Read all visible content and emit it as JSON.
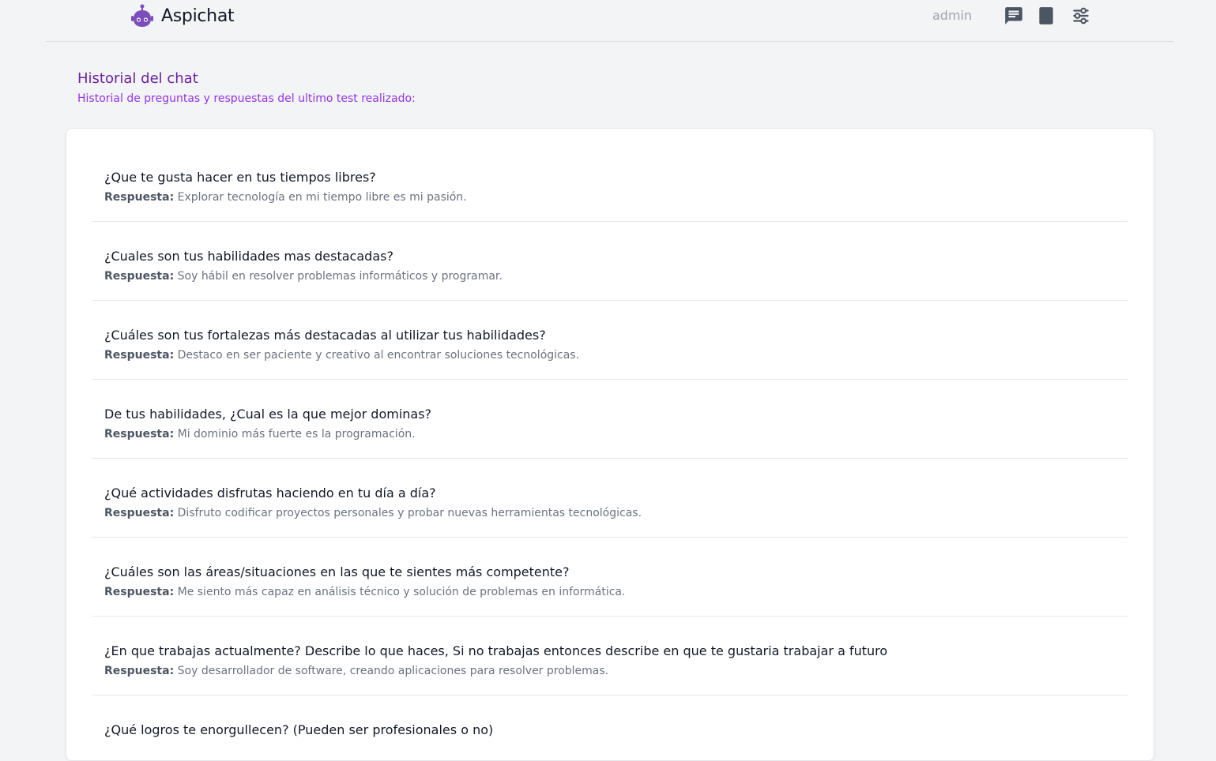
{
  "header": {
    "brand_name": "Aspichat",
    "user_name": "admin",
    "icons": [
      "chat-icon",
      "book-icon",
      "settings-sliders-icon"
    ]
  },
  "page": {
    "title": "Historial del chat",
    "subtitle": "Historial de preguntas y respuestas del ultimo test realizado:"
  },
  "qa": {
    "answer_label": "Respuesta:",
    "items": [
      {
        "question": "¿Que te gusta hacer en tus tiempos libres?",
        "answer": "Explorar tecnología en mi tiempo libre es mi pasión."
      },
      {
        "question": "¿Cuales son tus habilidades mas destacadas?",
        "answer": "Soy hábil en resolver problemas informáticos y programar."
      },
      {
        "question": "¿Cuáles son tus fortalezas más destacadas al utilizar tus habilidades?",
        "answer": "Destaco en ser paciente y creativo al encontrar soluciones tecnológicas."
      },
      {
        "question": "De tus habilidades, ¿Cual es la que mejor dominas?",
        "answer": "Mi dominio más fuerte es la programación."
      },
      {
        "question": "¿Qué actividades disfrutas haciendo en tu día a día?",
        "answer": "Disfruto codificar proyectos personales y probar nuevas herramientas tecnológicas."
      },
      {
        "question": "¿Cuáles son las áreas/situaciones en las que te sientes más competente?",
        "answer": "Me siento más capaz en análisis técnico y solución de problemas en informática."
      },
      {
        "question": "¿En que trabajas actualmente? Describe lo que haces, Si no trabajas entonces describe en que te gustaria trabajar a futuro",
        "answer": "Soy desarrollador de software, creando aplicaciones para resolver problemas."
      },
      {
        "question": "¿Qué logros te enorgullecen? (Pueden ser profesionales o no)",
        "answer": ""
      }
    ]
  },
  "colors": {
    "brand_purple": "#7c4dbc",
    "title_purple": "#6b21a8",
    "subtitle_purple": "#9333ea",
    "icon_gray": "#4b5563"
  }
}
